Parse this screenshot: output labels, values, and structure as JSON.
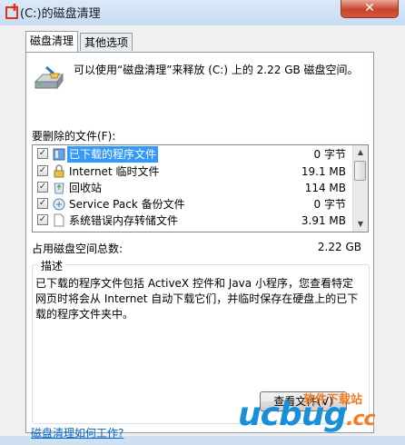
{
  "window": {
    "title": "(C:)的磁盘清理",
    "close_glyph": "✕"
  },
  "tabs": [
    {
      "label": "磁盘清理"
    },
    {
      "label": "其他选项"
    }
  ],
  "intro_text": "可以使用“磁盘清理”来释放  (C:) 上的 2.22 GB 磁盘空间。",
  "files_label": "要删除的文件(F):",
  "files": [
    {
      "name": "已下载的程序文件",
      "size": "0 字节",
      "checked": true,
      "icon": "folder-icon"
    },
    {
      "name": "Internet 临时文件",
      "size": "19.1 MB",
      "checked": true,
      "icon": "lock-icon"
    },
    {
      "name": "回收站",
      "size": "114 MB",
      "checked": true,
      "icon": "recycle-bin-icon"
    },
    {
      "name": "Service Pack 备份文件",
      "size": "0 字节",
      "checked": true,
      "icon": "package-icon"
    },
    {
      "name": "系统错误内存转储文件",
      "size": "3.91 MB",
      "checked": true,
      "icon": "document-icon"
    }
  ],
  "total": {
    "label": "占用磁盘空间总数:",
    "value": "2.22 GB"
  },
  "description": {
    "legend": "描述",
    "text": "已下载的程序文件包括 ActiveX 控件和 Java 小程序，您查看特定网页时将会从 Internet 自动下载它们，并临时保存在硬盘上的已下载的程序文件夹中。"
  },
  "view_files_button": "查看文件(V)",
  "help_link": "磁盘清理如何工作?",
  "watermark": {
    "logo": "ucbug",
    "suffix": ".cc",
    "caption": "软件下载站"
  },
  "colors": {
    "selection": "#3399ff",
    "link": "#0066cc",
    "close": "#c9432a",
    "wm_blue": "#1a8fd9",
    "wm_orange": "#f47b20"
  }
}
